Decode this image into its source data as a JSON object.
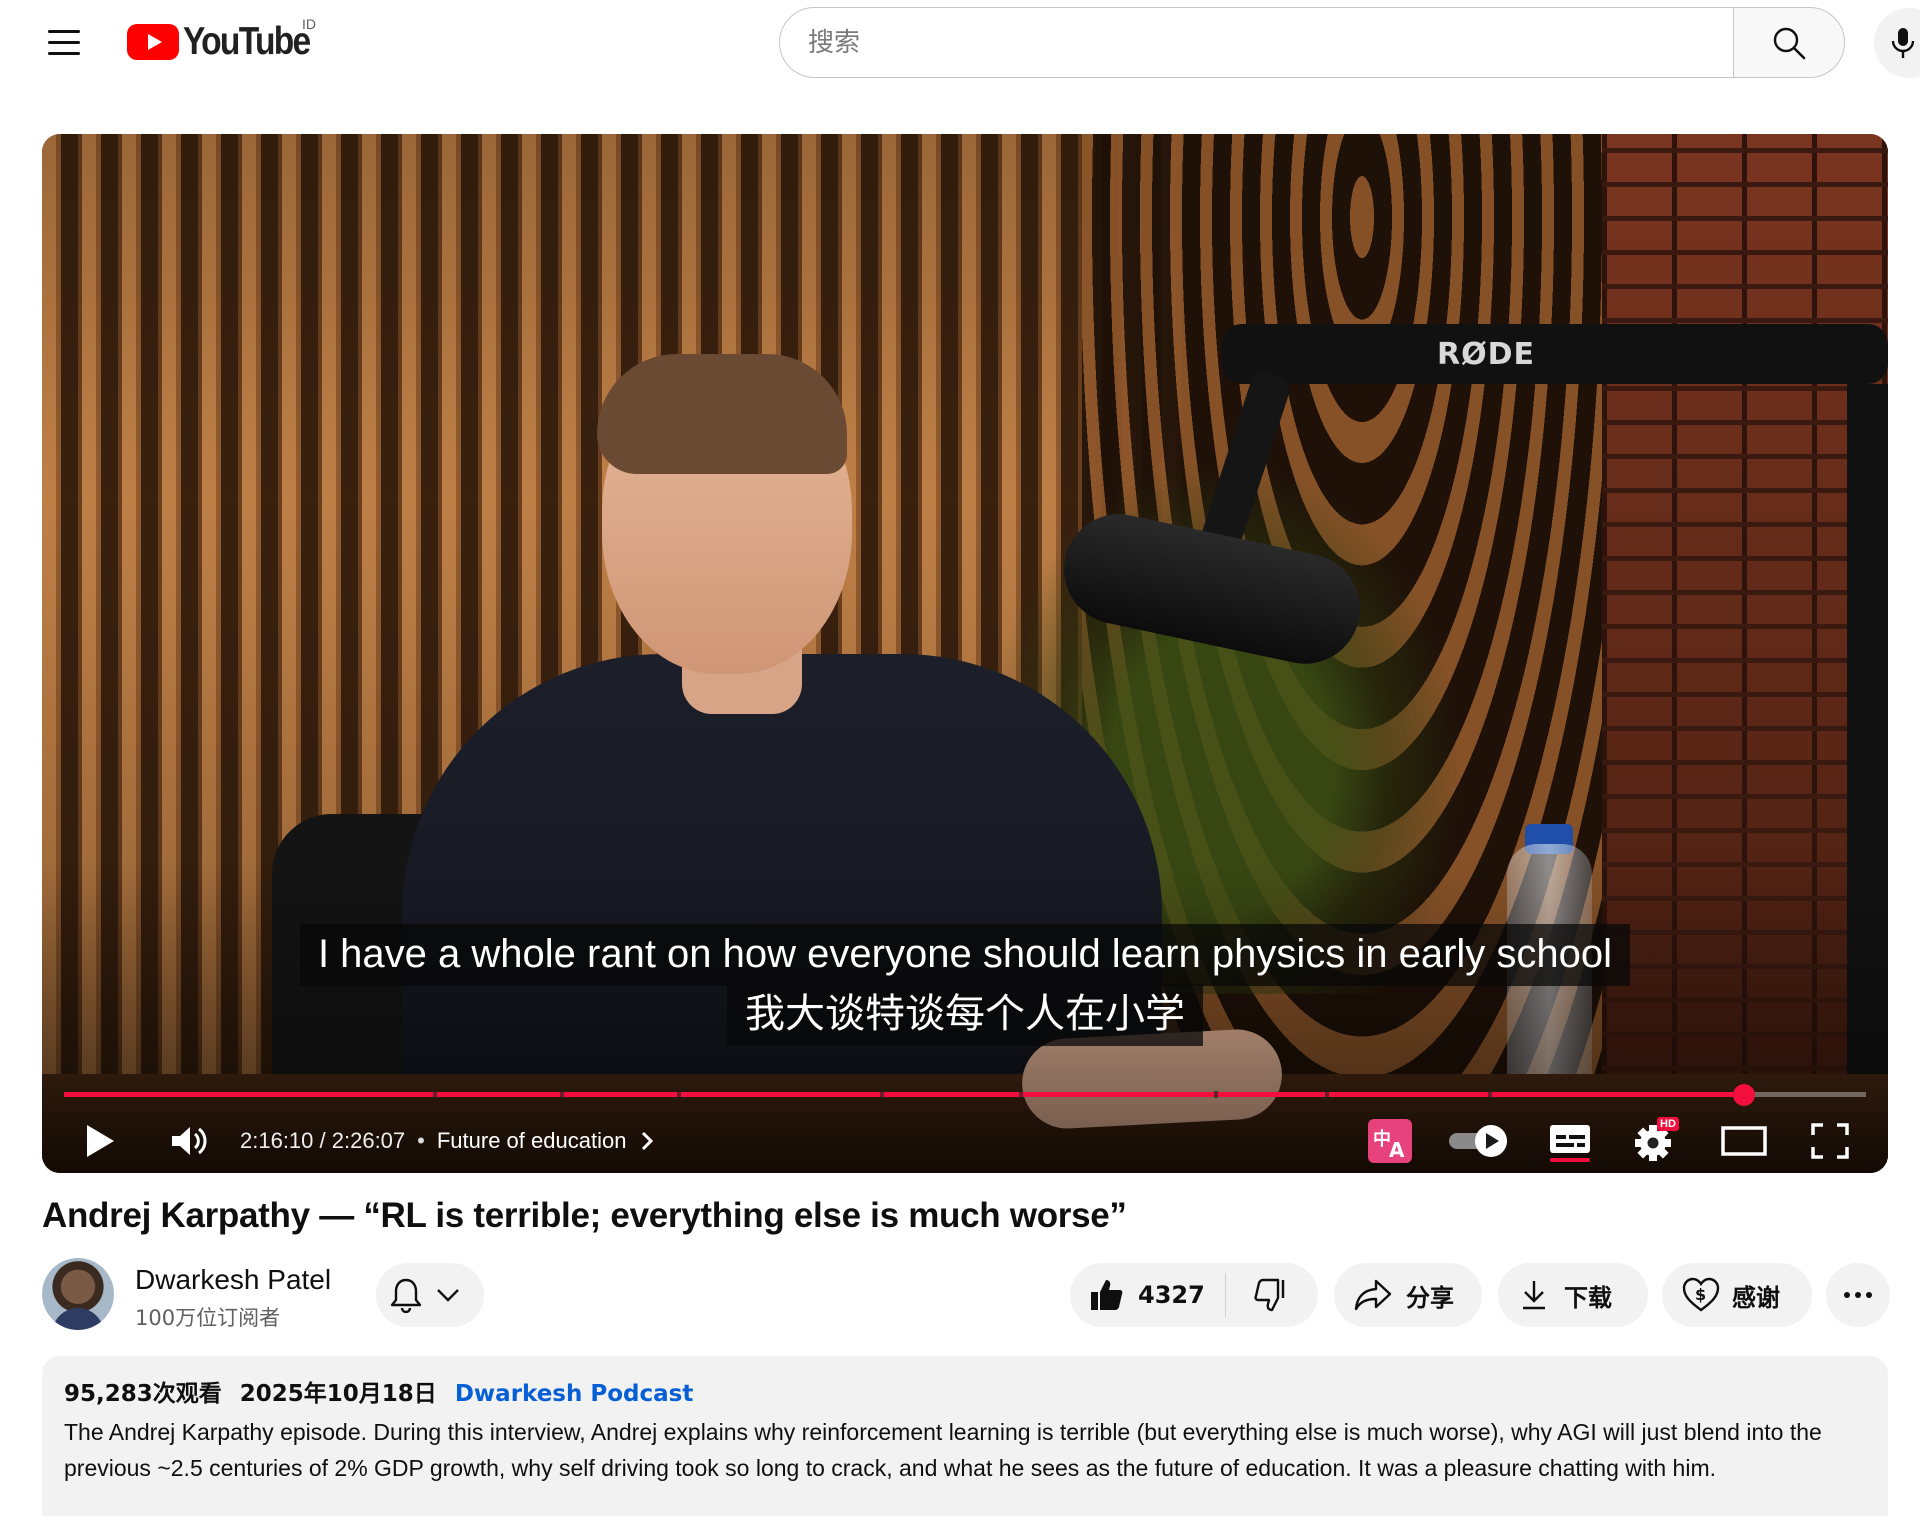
{
  "header": {
    "logo_text": "YouTube",
    "country_code": "ID",
    "search_placeholder": "搜索"
  },
  "player": {
    "captions": {
      "line1": "I have a whole rant on how everyone  should learn physics in early school",
      "line2": "我大谈特谈每个人在小学"
    },
    "current_time": "2:16:10",
    "duration": "2:26:07",
    "time_separator": " / ",
    "chapter_dot": "•",
    "chapter": "Future of education",
    "progress_fraction": 0.9323,
    "chapter_markers": [
      0.205,
      0.275,
      0.34,
      0.453,
      0.53,
      0.638,
      0.7,
      0.79
    ],
    "hd_badge": "HD",
    "accent_color": "#f20f3d"
  },
  "video": {
    "title": "Andrej Karpathy — “RL is terrible; everything else is much worse”"
  },
  "channel": {
    "name": "Dwarkesh Patel",
    "subscribers": "100万位订阅者"
  },
  "actions": {
    "like_count": "4327",
    "share_label": "分享",
    "download_label": "下载",
    "thanks_label": "感谢"
  },
  "description": {
    "views": "95,283次观看",
    "date": "2025年10月18日",
    "podcast_link": "Dwarkesh Podcast",
    "text": "The Andrej Karpathy episode. During this interview, Andrej explains why reinforcement learning is terrible (but everything else is much worse), why AGI will just blend into the previous ~2.5 centuries of 2% GDP growth, why self driving took so long to crack, and what he sees as the future of education. It was a pleasure chatting with him."
  }
}
